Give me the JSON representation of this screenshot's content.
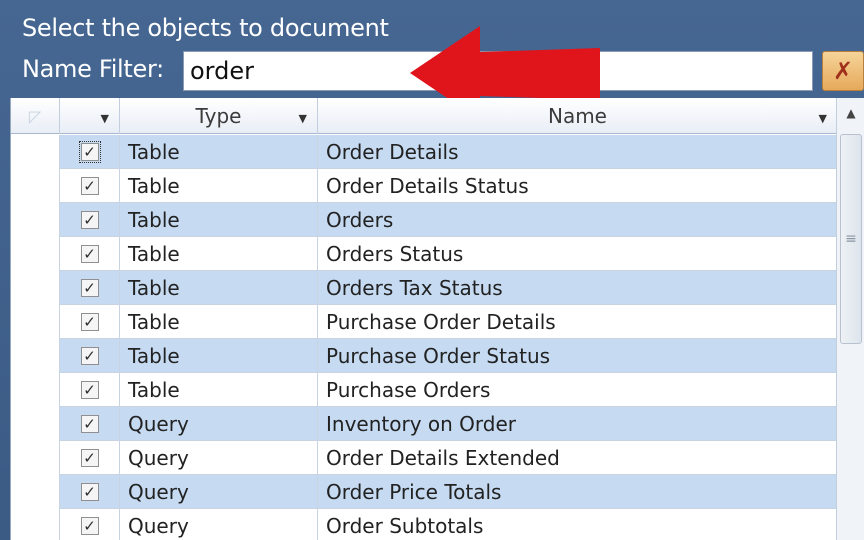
{
  "heading": "Select the objects to document",
  "filter": {
    "label": "Name Filter:",
    "value": "order"
  },
  "clear_button": {
    "icon": "clear-filter-icon"
  },
  "grid": {
    "columns": [
      {
        "label": ""
      },
      {
        "label": "Type"
      },
      {
        "label": "Name"
      }
    ],
    "rows": [
      {
        "checked": true,
        "type": "Table",
        "name": "Order Details"
      },
      {
        "checked": true,
        "type": "Table",
        "name": "Order Details Status"
      },
      {
        "checked": true,
        "type": "Table",
        "name": "Orders"
      },
      {
        "checked": true,
        "type": "Table",
        "name": "Orders Status"
      },
      {
        "checked": true,
        "type": "Table",
        "name": "Orders Tax Status"
      },
      {
        "checked": true,
        "type": "Table",
        "name": "Purchase Order Details"
      },
      {
        "checked": true,
        "type": "Table",
        "name": "Purchase Order Status"
      },
      {
        "checked": true,
        "type": "Table",
        "name": "Purchase Orders"
      },
      {
        "checked": true,
        "type": "Query",
        "name": "Inventory on Order"
      },
      {
        "checked": true,
        "type": "Query",
        "name": "Order Details Extended"
      },
      {
        "checked": true,
        "type": "Query",
        "name": "Order Price Totals"
      },
      {
        "checked": true,
        "type": "Query",
        "name": "Order Subtotals"
      }
    ]
  },
  "colors": {
    "panel": "#466792",
    "row_alt": "#c6dbf2",
    "arrow": "#e0141b"
  }
}
